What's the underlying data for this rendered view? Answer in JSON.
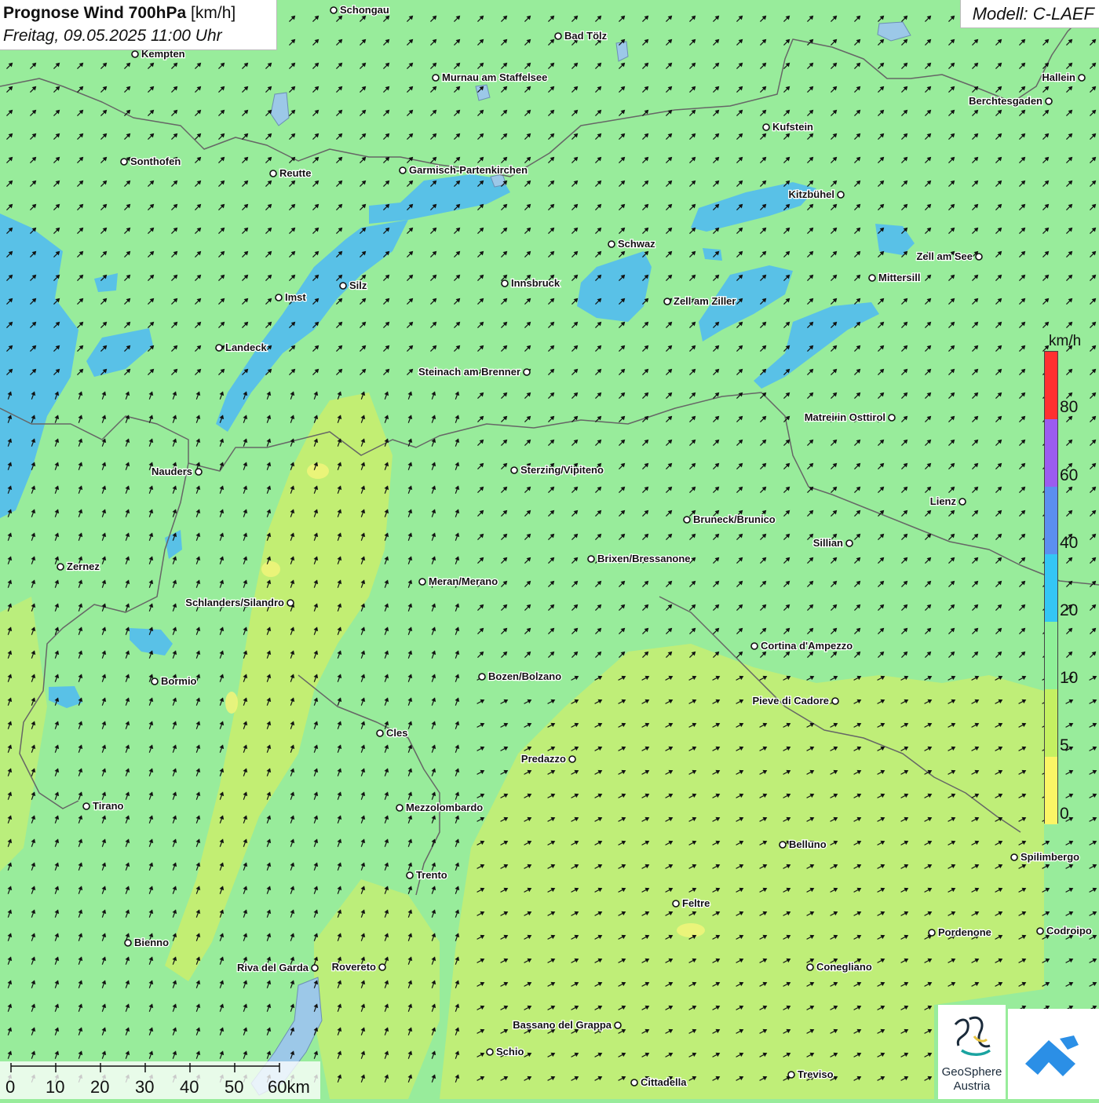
{
  "title": {
    "main": "Prognose Wind 700hPa",
    "unit": "[km/h]",
    "datetime": "Freitag, 09.05.2025 11:00 Uhr"
  },
  "model": "Modell: C-LAEF",
  "legend": {
    "unit": "km/h",
    "ticks": [
      "80",
      "60",
      "40",
      "20",
      "10",
      "5",
      "0"
    ],
    "colors": [
      "#ff3030",
      "#9b5cf0",
      "#5b8ff0",
      "#34c6f5",
      "#8ff098",
      "#c4f062",
      "#fbf566"
    ]
  },
  "scale": {
    "labels": [
      "0",
      "10",
      "20",
      "30",
      "40",
      "50",
      "60km"
    ]
  },
  "cities": [
    {
      "name": "Schongau"
    },
    {
      "name": "Bad Tölz"
    },
    {
      "name": "Kempten"
    },
    {
      "name": "Murnau am Staffelsee"
    },
    {
      "name": "Hallein"
    },
    {
      "name": "Berchtesgaden"
    },
    {
      "name": "Kufstein"
    },
    {
      "name": "Sonthofen"
    },
    {
      "name": "Reutte"
    },
    {
      "name": "Garmisch-Partenkirchen"
    },
    {
      "name": "Kitzbühel"
    },
    {
      "name": "Schwaz"
    },
    {
      "name": "Zell am See"
    },
    {
      "name": "Mittersill"
    },
    {
      "name": "Silz"
    },
    {
      "name": "Innsbruck"
    },
    {
      "name": "Imst"
    },
    {
      "name": "Zell am Ziller"
    },
    {
      "name": "Landeck"
    },
    {
      "name": "Steinach am Brenner"
    },
    {
      "name": "Matrei in Osttirol"
    },
    {
      "name": "Nauders"
    },
    {
      "name": "Sterzing/Vipiteno"
    },
    {
      "name": "Lienz"
    },
    {
      "name": "Bruneck/Brunico"
    },
    {
      "name": "Sillian"
    },
    {
      "name": "Zernez"
    },
    {
      "name": "Brixen/Bressanone"
    },
    {
      "name": "Meran/Merano"
    },
    {
      "name": "Schlanders/Silandro"
    },
    {
      "name": "Cortina d'Ampezzo"
    },
    {
      "name": "Bormio"
    },
    {
      "name": "Bozen/Bolzano"
    },
    {
      "name": "Pieve di Cadore"
    },
    {
      "name": "Cles"
    },
    {
      "name": "Predazzo"
    },
    {
      "name": "Tirano"
    },
    {
      "name": "Mezzolombardo"
    },
    {
      "name": "Belluno"
    },
    {
      "name": "Spilimbergo"
    },
    {
      "name": "Trento"
    },
    {
      "name": "Feltre"
    },
    {
      "name": "Bienno"
    },
    {
      "name": "Pordenone"
    },
    {
      "name": "Codroipo"
    },
    {
      "name": "Riva del Garda"
    },
    {
      "name": "Rovereto"
    },
    {
      "name": "Conegliano"
    },
    {
      "name": "Bassano del Grappa"
    },
    {
      "name": "Schio"
    },
    {
      "name": "Treviso"
    },
    {
      "name": "Cittadella"
    }
  ],
  "logos": {
    "geosphere_line1": "GeoSphere",
    "geosphere_line2": "Austria"
  }
}
